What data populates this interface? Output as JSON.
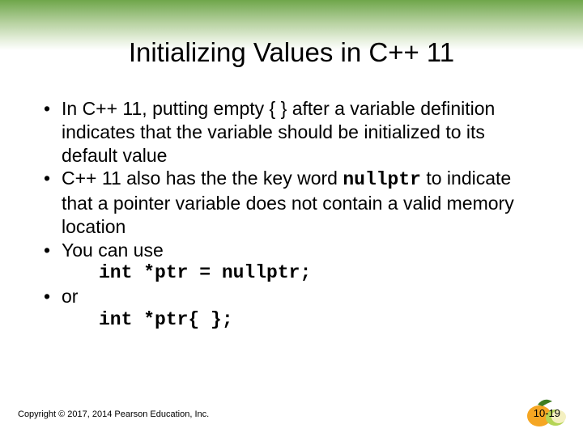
{
  "title": "Initializing Values in C++ 11",
  "bullets": [
    {
      "pre": "In C++ 11, putting empty { } after a variable definition indicates that the variable should be initialized to its default value"
    },
    {
      "pre": "C++ 11 also has the the key word ",
      "code": "nullptr",
      "post": " to indicate that a pointer variable does not contain a valid memory location"
    },
    {
      "pre": "You can use"
    }
  ],
  "code1": "int *ptr = nullptr;",
  "bullet4": "or",
  "code2": "int *ptr{ };",
  "copyright": "Copyright © 2017, 2014 Pearson Education, Inc.",
  "pagenum": "10-19"
}
